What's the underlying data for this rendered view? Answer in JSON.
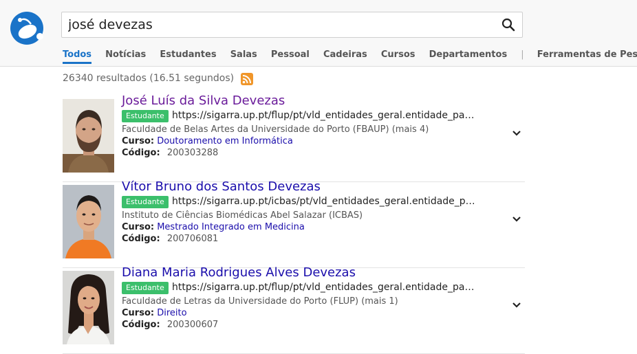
{
  "search": {
    "query": "josé devezas"
  },
  "tabs": [
    {
      "label": "Todos",
      "active": true
    },
    {
      "label": "Notícias"
    },
    {
      "label": "Estudantes"
    },
    {
      "label": "Salas"
    },
    {
      "label": "Pessoal"
    },
    {
      "label": "Cadeiras"
    },
    {
      "label": "Cursos"
    },
    {
      "label": "Departamentos"
    },
    {
      "label": "|"
    },
    {
      "label": "Ferramentas de Pesquisa"
    }
  ],
  "stats": "26340 resultados (16.51 segundos)",
  "results": [
    {
      "name": "José Luís da Silva Devezas",
      "badge": "Estudante",
      "url": "https://sigarra.up.pt/flup/pt/vld_entidades_geral.entidade_pa…",
      "faculty": "Faculdade de Belas Artes da Universidade do Porto (FBAUP) (mais 4)",
      "course_label": "Curso:",
      "course": "Doutoramento em Informática",
      "code_label": "Código:",
      "code": "200303288"
    },
    {
      "name": "Vítor Bruno dos Santos Devezas",
      "badge": "Estudante",
      "url": "https://sigarra.up.pt/icbas/pt/vld_entidades_geral.entidade_p…",
      "faculty": "Instituto de Ciências Biomédicas Abel Salazar (ICBAS)",
      "course_label": "Curso:",
      "course": "Mestrado Integrado em Medicina",
      "code_label": "Código:",
      "code": "200706081"
    },
    {
      "name": "Diana Maria Rodrigues Alves Devezas",
      "badge": "Estudante",
      "url": "https://sigarra.up.pt/flup/pt/vld_entidades_geral.entidade_pa…",
      "faculty": "Faculdade de Letras da Universidade do Porto (FLUP) (mais 1)",
      "course_label": "Curso:",
      "course": "Direito",
      "code_label": "Código:",
      "code": "200300607"
    }
  ],
  "colors": {
    "accent": "#1a73c8",
    "link": "#1a0dab",
    "visited": "#6a1b9a",
    "badge": "#3bbf6b",
    "rss": "#f0962a"
  },
  "icons": {
    "logo": "mouse-logo-icon",
    "search": "search-icon",
    "rss": "rss-icon",
    "expand": "chevron-down-icon"
  }
}
